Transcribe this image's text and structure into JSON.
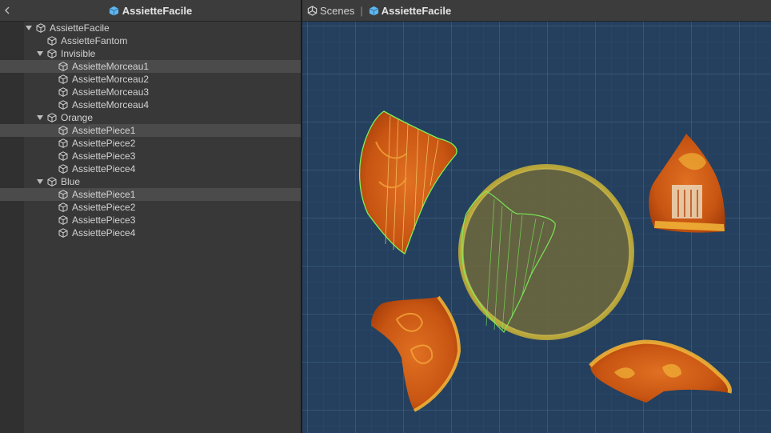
{
  "hierarchy": {
    "title": "AssietteFacile",
    "items": [
      {
        "label": "AssietteFacile",
        "depth": 0,
        "expanded": true,
        "selected": false
      },
      {
        "label": "AssietteFantom",
        "depth": 1,
        "expanded": null,
        "selected": false
      },
      {
        "label": "Invisible",
        "depth": 1,
        "expanded": true,
        "selected": false
      },
      {
        "label": "AssietteMorceau1",
        "depth": 2,
        "expanded": null,
        "selected": true
      },
      {
        "label": "AssietteMorceau2",
        "depth": 2,
        "expanded": null,
        "selected": false
      },
      {
        "label": "AssietteMorceau3",
        "depth": 2,
        "expanded": null,
        "selected": false
      },
      {
        "label": "AssietteMorceau4",
        "depth": 2,
        "expanded": null,
        "selected": false
      },
      {
        "label": "Orange",
        "depth": 1,
        "expanded": true,
        "selected": false
      },
      {
        "label": "AssiettePiece1",
        "depth": 2,
        "expanded": null,
        "selected": true
      },
      {
        "label": "AssiettePiece2",
        "depth": 2,
        "expanded": null,
        "selected": false
      },
      {
        "label": "AssiettePiece3",
        "depth": 2,
        "expanded": null,
        "selected": false
      },
      {
        "label": "AssiettePiece4",
        "depth": 2,
        "expanded": null,
        "selected": false
      },
      {
        "label": "Blue",
        "depth": 1,
        "expanded": true,
        "selected": false
      },
      {
        "label": "AssiettePiece1",
        "depth": 2,
        "expanded": null,
        "selected": true
      },
      {
        "label": "AssiettePiece2",
        "depth": 2,
        "expanded": null,
        "selected": false
      },
      {
        "label": "AssiettePiece3",
        "depth": 2,
        "expanded": null,
        "selected": false
      },
      {
        "label": "AssiettePiece4",
        "depth": 2,
        "expanded": null,
        "selected": false
      }
    ]
  },
  "scene": {
    "breadcrumb_root": "Scenes",
    "breadcrumb_current": "AssietteFacile"
  },
  "icons": {
    "back": "chevron-left-icon",
    "prefab": "prefab-cube-icon",
    "gameobject": "cube-outline-icon",
    "scenes": "unity-logo-icon"
  },
  "colors": {
    "panel_bg": "#383838",
    "header_bg": "#3c3c3c",
    "selection": "#4b4b4b",
    "scene_bg": "#24405e",
    "prefab_blue": "#5fb6f0",
    "collider_green": "#7cf25a",
    "plate_orange": "#d9641a",
    "ghost_plate": "#c9b33a"
  }
}
